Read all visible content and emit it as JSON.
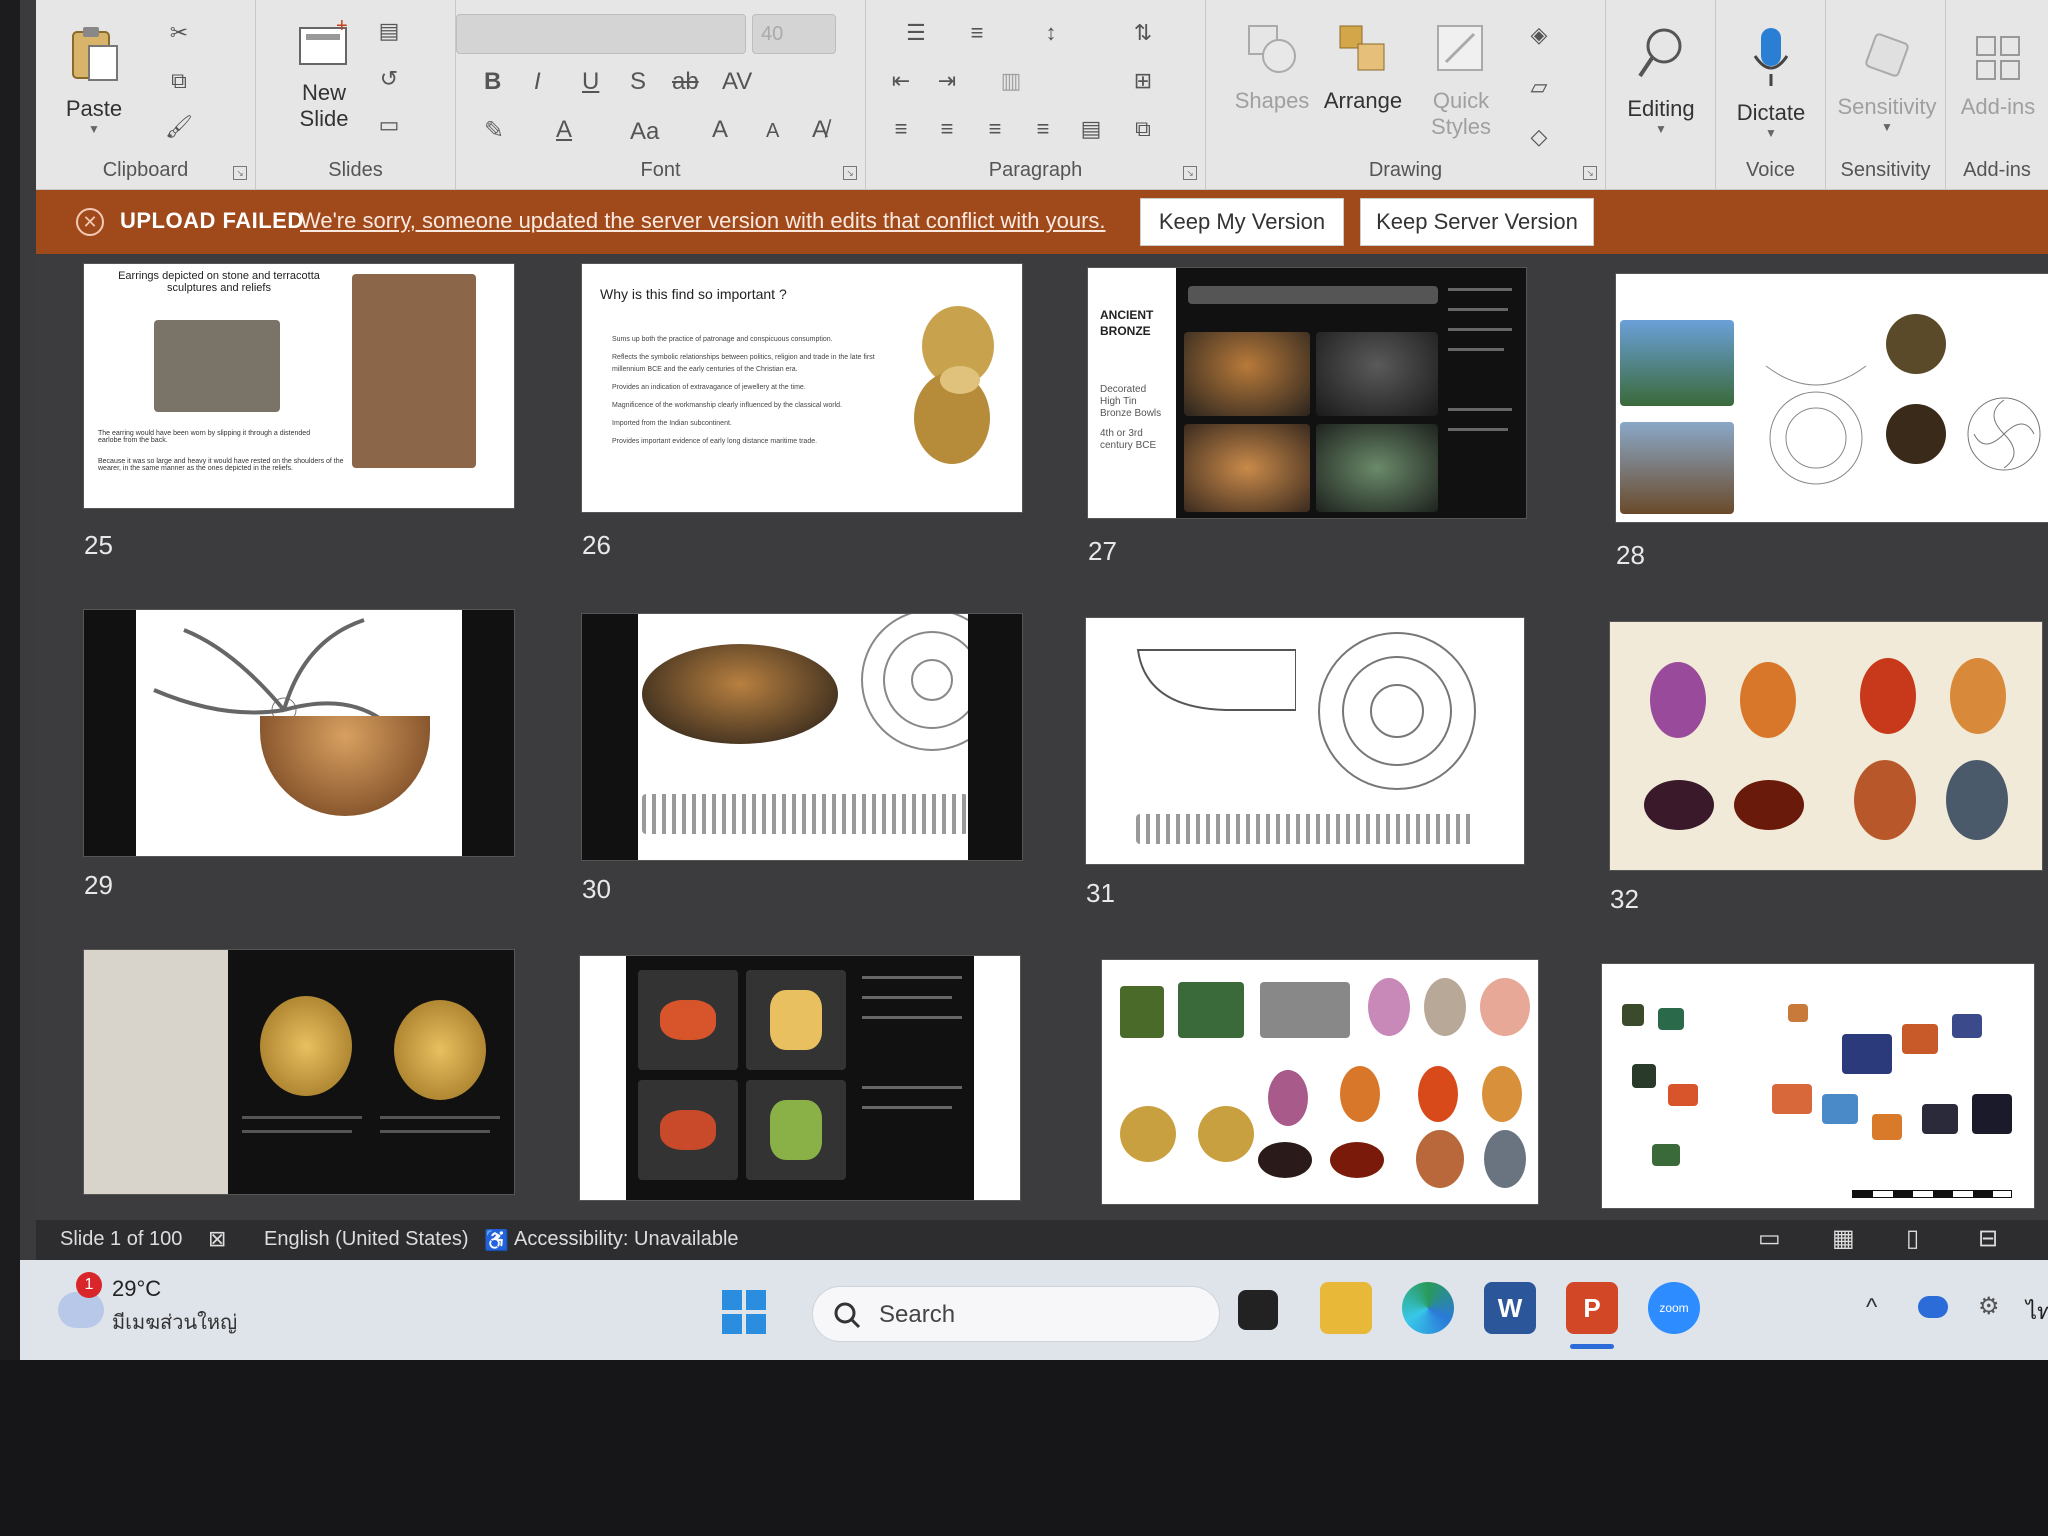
{
  "ribbon": {
    "clipboard": {
      "paste": "Paste",
      "label": "Clipboard"
    },
    "slides": {
      "new_slide_1": "New",
      "new_slide_2": "Slide",
      "label": "Slides"
    },
    "font": {
      "size": "40",
      "label": "Font",
      "bold": "B",
      "italic": "I",
      "underline": "U",
      "shadow": "S",
      "strike": "ab",
      "spacing": "AV",
      "case": "Aa",
      "grow": "A",
      "shrink": "A"
    },
    "paragraph": {
      "label": "Paragraph"
    },
    "drawing": {
      "shapes": "Shapes",
      "arrange": "Arrange",
      "quick_1": "Quick",
      "quick_2": "Styles",
      "label": "Drawing"
    },
    "editing": {
      "label": "Editing"
    },
    "voice": {
      "dictate": "Dictate",
      "label": "Voice"
    },
    "sensitivity": {
      "button": "Sensitivity",
      "label": "Sensitivity"
    },
    "addins": {
      "button": "Add-ins",
      "label": "Add-ins"
    }
  },
  "infobar": {
    "title": "UPLOAD FAILED",
    "message": "We're sorry, someone updated the server version with edits that conflict with yours.",
    "keep_mine": "Keep My Version",
    "keep_server": "Keep Server Version"
  },
  "slides": [
    {
      "number": "25",
      "title": "Earrings depicted on stone and terracotta sculptures and reliefs",
      "bullet_1": "The earring would have been worn by slipping it through a distended earlobe from the back.",
      "bullet_2": "Because it was so large and heavy it would have rested on the shoulders of the wearer, in the same manner as the ones depicted in the reliefs."
    },
    {
      "number": "26",
      "title": "Why is this find so important ?",
      "bullets": [
        "Sums up both the practice of patronage and conspicuous consumption.",
        "Reflects the symbolic relationships between politics, religion and trade in the late first millennium BCE and the early centuries of the Christian era.",
        "Provides an indication of extravagance of jewellery at the time.",
        "Magnificence of the workmanship clearly influenced by the classical world.",
        "Imported from the Indian subcontinent.",
        "Provides important evidence of early long distance maritime trade."
      ]
    },
    {
      "number": "27",
      "heading_1": "ANCIENT",
      "heading_2": "BRONZE",
      "caption_1": "Decorated",
      "caption_2": "High Tin",
      "caption_3": "Bronze Bowls",
      "caption_4": "4th or 3rd",
      "caption_5": "century BCE"
    },
    {
      "number": "28"
    },
    {
      "number": "29"
    },
    {
      "number": "30"
    },
    {
      "number": "31"
    },
    {
      "number": "32"
    },
    {
      "number": ""
    },
    {
      "number": ""
    },
    {
      "number": ""
    },
    {
      "number": ""
    }
  ],
  "status": {
    "slide_count": "Slide 1 of 100",
    "language": "English (United States)",
    "accessibility": "Accessibility: Unavailable"
  },
  "taskbar": {
    "temperature": "29°C",
    "weather": "มีเมฆส่วนใหญ่",
    "weather_badge": "1",
    "search": "Search",
    "zoom": "zoom",
    "lang": "ไท"
  },
  "colors": {
    "infobar": "#a04a1c",
    "ribbon": "#e6e6e6",
    "sorter": "#3c3c3e",
    "taskbar": "#dfe3ea"
  }
}
